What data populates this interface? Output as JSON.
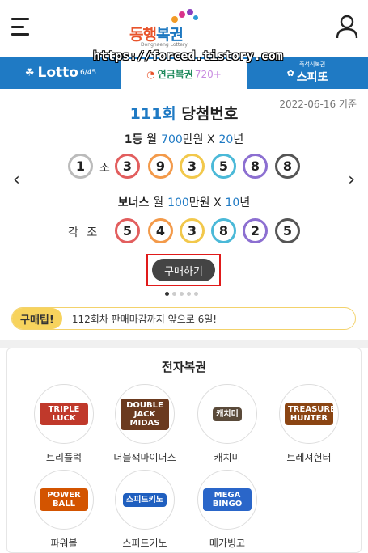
{
  "header": {
    "logo_part1": "동행",
    "logo_part2": "복권",
    "logo_sub": "Donghaeng Lottery"
  },
  "watermark": "https://forced.tistory.com",
  "tabs": [
    {
      "label": "Lotto",
      "sub": "6/45"
    },
    {
      "label": "연금복권",
      "sub": "720+"
    },
    {
      "label": "스피또",
      "sub": "즉석식복권"
    }
  ],
  "draw": {
    "round": "111회",
    "title": "당첨번호",
    "date": "2022-06-16 기준",
    "first_prize": {
      "rank": "1등",
      "pre": "월",
      "amount": "700",
      "unit": "만원 X",
      "years": "20",
      "years_unit": "년"
    },
    "first_jo": "1",
    "jo_label": "조",
    "first_numbers": [
      "3",
      "9",
      "3",
      "5",
      "8",
      "8"
    ],
    "bonus_prize": {
      "rank": "보너스",
      "pre": "월",
      "amount": "100",
      "unit": "만원 X",
      "years": "10",
      "years_unit": "년"
    },
    "bonus_label": "각 조",
    "bonus_numbers": [
      "5",
      "4",
      "3",
      "8",
      "2",
      "5"
    ],
    "ball_colors": [
      "#e25e5e",
      "#f39a4a",
      "#f2c84b",
      "#4bb9d8",
      "#8c6fd1",
      "#555555"
    ],
    "jo_ball_color": "#bbbbbb",
    "prev_arrow": "‹",
    "next_arrow": "›"
  },
  "buy_button": "구매하기",
  "carousel": {
    "count": 5,
    "active": 0
  },
  "tip": {
    "badge": "구매팁!",
    "text": "112회차 판매마감까지 앞으로 6일!"
  },
  "elottery": {
    "title": "전자복권",
    "games": [
      {
        "name": "트리플럭",
        "logo": "TRIPLE LUCK",
        "color": "#c0392b"
      },
      {
        "name": "더블잭마이더스",
        "logo": "DOUBLE JACK MIDAS",
        "color": "#6b3a1f"
      },
      {
        "name": "캐치미",
        "logo": "캐치미",
        "color": "#5a4a3a"
      },
      {
        "name": "트레져헌터",
        "logo": "TREASURE HUNTER",
        "color": "#8b4513"
      },
      {
        "name": "파워볼",
        "logo": "POWER BALL",
        "color": "#d35400"
      },
      {
        "name": "스피드키노",
        "logo": "스피드키노",
        "color": "#1f5fbf"
      },
      {
        "name": "메가빙고",
        "logo": "MEGA BINGO",
        "color": "#2a66c9"
      }
    ]
  },
  "colors": {
    "brand_blue": "#1f7ac4",
    "tip_yellow": "#f7d35d",
    "highlight_red": "#e01a1a"
  }
}
